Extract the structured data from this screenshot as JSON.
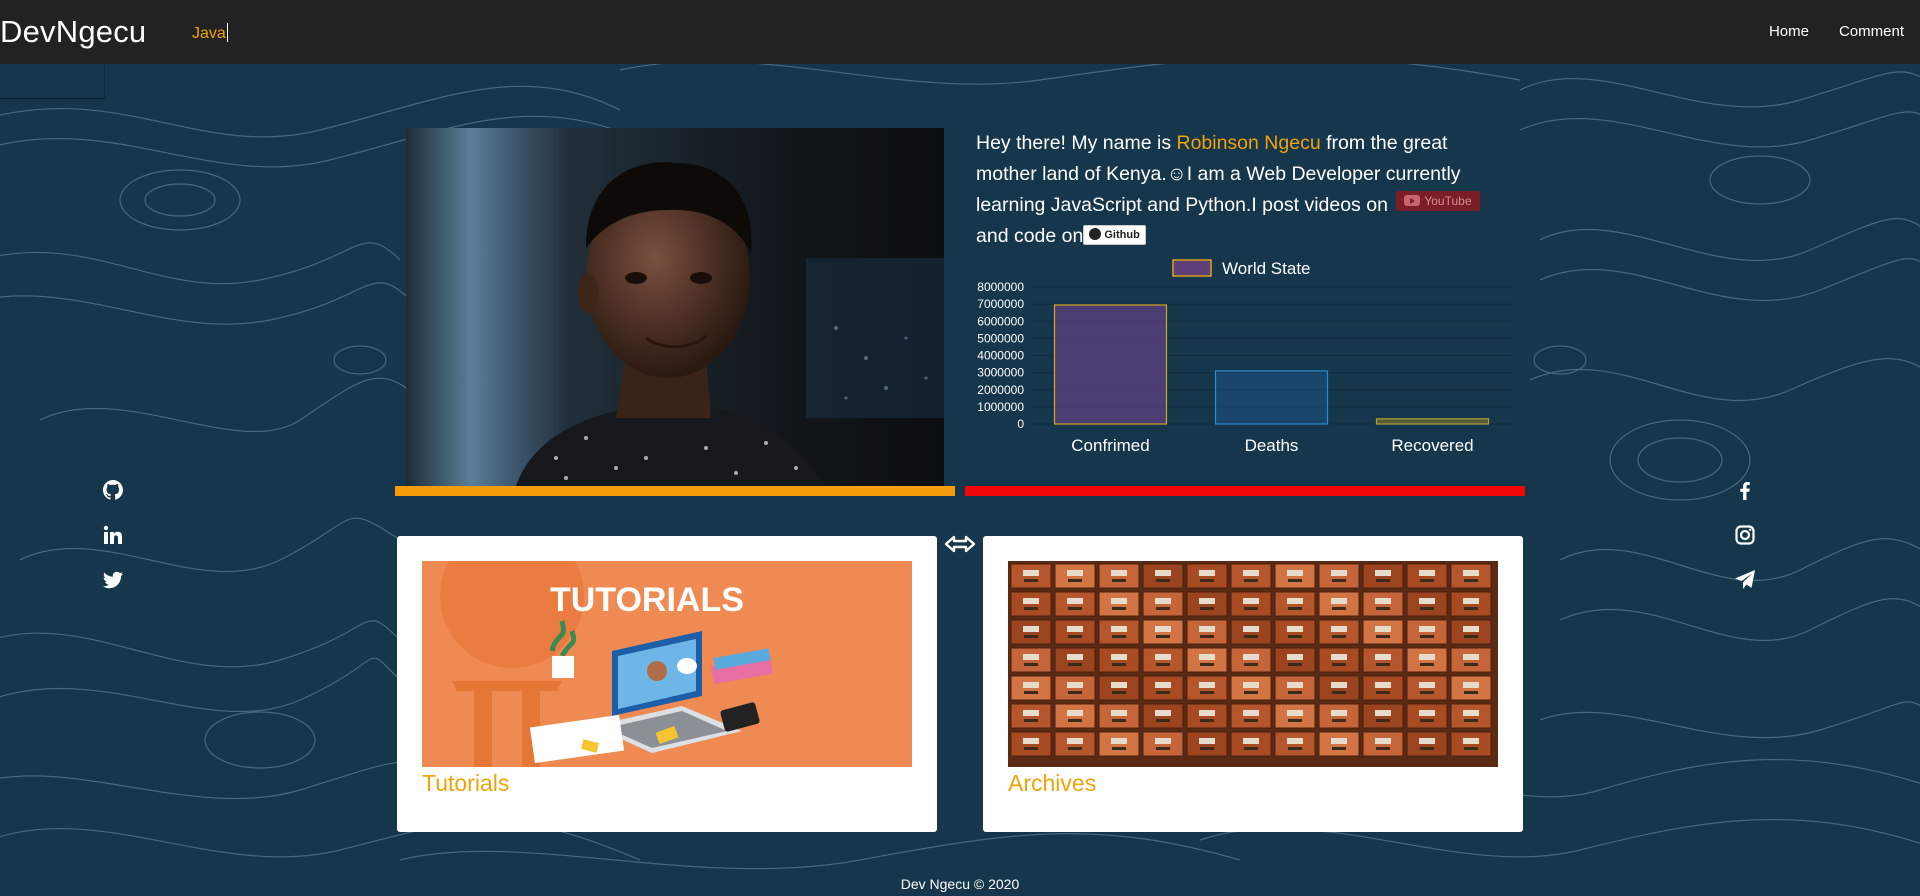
{
  "navbar": {
    "brand": "DevNgecu",
    "typed_text": "Java",
    "links": [
      "Home",
      "Comment"
    ]
  },
  "intro": {
    "greeting": "Hey there! My name is ",
    "name": "Robinson Ngecu",
    "text_after_name": " from the great mother land of Kenya.☺I am a Web Developer currently learning JavaScript and Python.I post videos on ",
    "youtube_label": "YouTube",
    "text_before_github": "and code on",
    "github_label": "Github"
  },
  "chart_data": {
    "type": "bar",
    "series": [
      {
        "name": "World State",
        "values": [
          6950000,
          3100000,
          300000
        ]
      }
    ],
    "categories": [
      "Confrimed",
      "Deaths",
      "Recovered"
    ],
    "bar_fills": [
      "rgba(120,70,150,0.55)",
      "rgba(40,120,200,0.25)",
      "rgba(150,130,40,0.5)"
    ],
    "bar_borders": [
      "#d9a420",
      "#2a8ad4",
      "#b8a030"
    ],
    "legend_swatch": "#5e3f7a",
    "legend_border": "#d9a420",
    "y_ticks": [
      0,
      1000000,
      2000000,
      3000000,
      4000000,
      5000000,
      6000000,
      7000000,
      8000000
    ],
    "ylim": [
      0,
      8000000
    ],
    "legend_position": "top"
  },
  "cards": [
    {
      "title": "Tutorials",
      "banner_text": "TUTORIALS"
    },
    {
      "title": "Archives"
    }
  ],
  "social_left": [
    "github-icon",
    "linkedin-icon",
    "twitter-icon"
  ],
  "social_right": [
    "facebook-icon",
    "instagram-icon",
    "telegram-icon"
  ],
  "colors": {
    "accent_orange": "#f0a30a",
    "bar_orange": "#f59d0a",
    "bar_red": "#f10707",
    "navbar": "#222222",
    "background": "#15364b"
  },
  "footer": "Dev Ngecu © 2020"
}
